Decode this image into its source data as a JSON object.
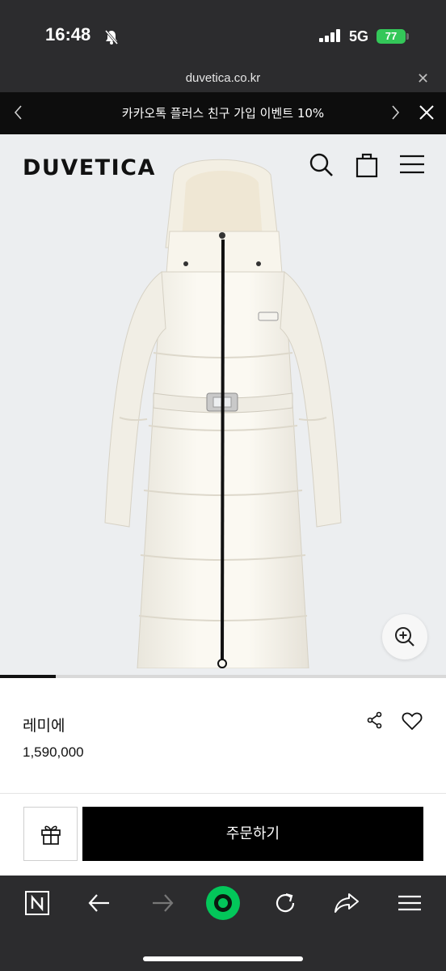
{
  "status_bar": {
    "time": "16:48",
    "network": "5G",
    "battery": "77",
    "icons": [
      "bell-slash-icon",
      "signal-icon",
      "battery-charging-icon"
    ]
  },
  "browser": {
    "url": "duvetica.co.kr",
    "close_icon": "close-icon"
  },
  "promo": {
    "text": "카카오톡 플러스 친구 가입 이벤트 10%",
    "icons": [
      "chevron-left-icon",
      "chevron-right-icon",
      "close-icon"
    ]
  },
  "header": {
    "logo": "DUVETICA",
    "icons": [
      "search-icon",
      "shopping-bag-icon",
      "hamburger-menu-icon"
    ]
  },
  "gallery": {
    "image": "white long down puffer coat with hood and belt",
    "zoom_icon": "zoom-in-icon",
    "progress": 0.125
  },
  "product": {
    "name": "레미에",
    "price": "1,590,000",
    "icons": [
      "share-icon",
      "heart-icon"
    ]
  },
  "actions": {
    "gift_icon": "gift-icon",
    "order_label": "주문하기"
  },
  "toolbar": {
    "icons": [
      "naver-n-icon",
      "back-arrow-icon",
      "forward-arrow-icon",
      "green-home-icon",
      "refresh-icon",
      "share-arrow-icon",
      "menu-icon"
    ]
  },
  "colors": {
    "dark_chrome": "#2c2c2e",
    "banner": "#0d0d0d",
    "hero_bg": "#eceef0",
    "battery_green": "#34c759",
    "naver_green": "#03c75a"
  }
}
